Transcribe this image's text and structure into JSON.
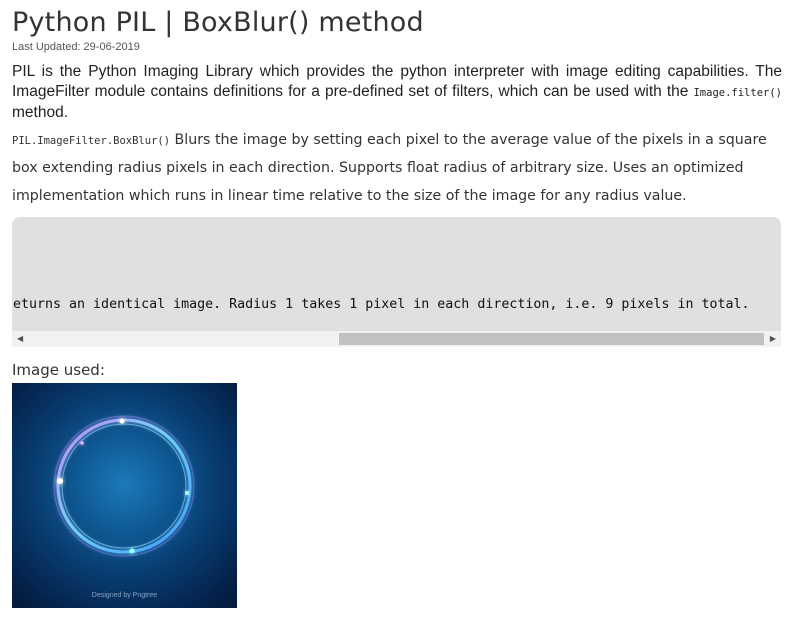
{
  "article": {
    "title": "Python PIL | BoxBlur() method",
    "last_updated": "Last Updated: 29-06-2019",
    "intro_text": "PIL is the Python Imaging Library which provides the python interpreter with image editing capabilities. The ImageFilter module contains definitions for a pre-defined set of filters, which can be used with the",
    "intro_code": "Image.filter()",
    "intro_tail": " method.",
    "desc_code": "PIL.ImageFilter.BoxBlur()",
    "desc_text": " Blurs the image by setting each pixel to the average value of the pixels in a square box extending radius pixels in each direction. Supports float radius of arbitrary size. Uses an optimized implementation which runs in linear time relative to the size of the image for any radius value."
  },
  "code_block": {
    "visible_line": "eturns an identical image. Radius 1 takes 1 pixel in each direction, i.e. 9 pixels in total.",
    "scroll_left_icon": "triangle-left",
    "scroll_right_icon": "triangle-right"
  },
  "image_section": {
    "label": "Image used:",
    "watermark": "Designed by Pngtree"
  }
}
